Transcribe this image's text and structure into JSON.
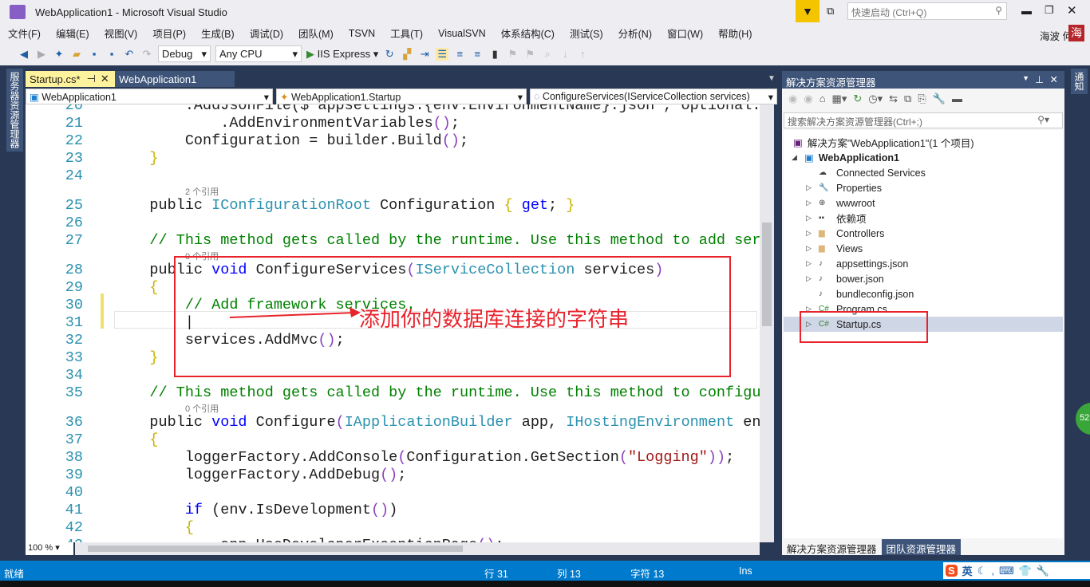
{
  "window": {
    "title": "WebApplication1 - Microsoft Visual Studio",
    "quick_launch_placeholder": "快速启动 (Ctrl+Q)",
    "user": "海波 何",
    "avatar": "海"
  },
  "menu": [
    "文件(F)",
    "编辑(E)",
    "视图(V)",
    "项目(P)",
    "生成(B)",
    "调试(D)",
    "团队(M)",
    "TSVN",
    "工具(T)",
    "VisualSVN",
    "体系结构(C)",
    "测试(S)",
    "分析(N)",
    "窗口(W)",
    "帮助(H)"
  ],
  "toolbar": {
    "configuration": "Debug",
    "platform": "Any CPU",
    "run_target": "IIS Express"
  },
  "left_strip": "服务器资源管理器",
  "right_strip": "通知",
  "tabs": [
    {
      "label": "Startup.cs*",
      "active": true
    },
    {
      "label": "WebApplication1",
      "active": false
    }
  ],
  "nav": {
    "project": "WebApplication1",
    "class": "WebApplication1.Startup",
    "member": "ConfigureServices(IServiceCollection services)"
  },
  "editor": {
    "zoom": "100 %",
    "lines": [
      {
        "n": "20",
        "seg": [
          [
            "        .AddJsonFile($\"appsettings.{env.EnvironmentName}.json\", optional: true)",
            ""
          ]
        ]
      },
      {
        "n": "21",
        "seg": [
          [
            "            .AddEnvironmentVariables",
            ""
          ],
          [
            "()",
            "pn"
          ],
          [
            ";",
            ""
          ]
        ]
      },
      {
        "n": "22",
        "seg": [
          [
            "        Configuration = builder.Build",
            ""
          ],
          [
            "()",
            "pn"
          ],
          [
            ";",
            ""
          ]
        ]
      },
      {
        "n": "23",
        "seg": [
          [
            "    }",
            "br"
          ]
        ]
      },
      {
        "n": "24",
        "seg": []
      },
      {
        "lens": "2 个引用"
      },
      {
        "n": "25",
        "seg": [
          [
            "    public ",
            ""
          ],
          [
            "IConfigurationRoot",
            "ty"
          ],
          [
            " Configuration ",
            ""
          ],
          [
            "{",
            "br"
          ],
          [
            " ",
            ""
          ],
          [
            "get",
            "kw"
          ],
          [
            "; ",
            ""
          ],
          [
            "}",
            "br"
          ]
        ]
      },
      {
        "n": "26",
        "seg": []
      },
      {
        "n": "27",
        "seg": [
          [
            "    // This method gets called by the runtime. Use this method to add services to the container.",
            "cm"
          ]
        ]
      },
      {
        "lens": "0 个引用"
      },
      {
        "n": "28",
        "seg": [
          [
            "    public ",
            ""
          ],
          [
            "void",
            "kw"
          ],
          [
            " ConfigureServices",
            ""
          ],
          [
            "(",
            "pn"
          ],
          [
            "IServiceCollection",
            "ty"
          ],
          [
            " services",
            ""
          ],
          [
            ")",
            "pn"
          ]
        ]
      },
      {
        "n": "29",
        "seg": [
          [
            "    {",
            "br"
          ]
        ]
      },
      {
        "n": "30",
        "seg": [
          [
            "        // Add framework services.",
            "cm"
          ]
        ]
      },
      {
        "n": "31",
        "seg": [
          [
            "        |",
            ""
          ]
        ]
      },
      {
        "n": "32",
        "seg": [
          [
            "        services.AddMvc",
            ""
          ],
          [
            "()",
            "pn"
          ],
          [
            ";",
            ""
          ]
        ]
      },
      {
        "n": "33",
        "seg": [
          [
            "    }",
            "br"
          ]
        ]
      },
      {
        "n": "34",
        "seg": []
      },
      {
        "n": "35",
        "seg": [
          [
            "    // This method gets called by the runtime. Use this method to configure the HTTP request pipeline.",
            "cm"
          ]
        ]
      },
      {
        "lens": "0 个引用"
      },
      {
        "n": "36",
        "seg": [
          [
            "    public ",
            ""
          ],
          [
            "void",
            "kw"
          ],
          [
            " Configure",
            ""
          ],
          [
            "(",
            "pn"
          ],
          [
            "IApplicationBuilder",
            "ty"
          ],
          [
            " app, ",
            ""
          ],
          [
            "IHostingEnvironment",
            "ty"
          ],
          [
            " env",
            ""
          ]
        ]
      },
      {
        "n": "37",
        "seg": [
          [
            "    {",
            "br"
          ]
        ]
      },
      {
        "n": "38",
        "seg": [
          [
            "        loggerFactory.AddConsole",
            ""
          ],
          [
            "(",
            "pn"
          ],
          [
            "Configuration.GetSection",
            ""
          ],
          [
            "(",
            "pn"
          ],
          [
            "\"Logging\"",
            "st"
          ],
          [
            "))",
            "pn"
          ],
          [
            ";",
            ""
          ]
        ]
      },
      {
        "n": "39",
        "seg": [
          [
            "        loggerFactory.AddDebug",
            ""
          ],
          [
            "()",
            "pn"
          ],
          [
            ";",
            ""
          ]
        ]
      },
      {
        "n": "40",
        "seg": []
      },
      {
        "n": "41",
        "seg": [
          [
            "        ",
            ""
          ],
          [
            "if",
            "kw"
          ],
          [
            " (env.IsDevelopment",
            ""
          ],
          [
            "()",
            "pn"
          ],
          [
            ")",
            ""
          ]
        ]
      },
      {
        "n": "42",
        "seg": [
          [
            "        {",
            "br"
          ]
        ]
      },
      {
        "n": "43",
        "seg": [
          [
            "            app.UseDeveloperExceptionPage",
            ""
          ],
          [
            "()",
            "pn"
          ],
          [
            ";",
            ""
          ]
        ]
      }
    ]
  },
  "annotation": {
    "text": "添加你的数据库连接的字符串",
    "color": "#e8232c"
  },
  "solution_explorer": {
    "title": "解决方案资源管理器",
    "search_placeholder": "搜索解决方案资源管理器(Ctrl+;)",
    "root": "解决方案\"WebApplication1\"(1 个项目)",
    "project": "WebApplication1",
    "items": [
      {
        "label": "Connected Services",
        "icon": "cloud-icon",
        "exp": false
      },
      {
        "label": "Properties",
        "icon": "wrench-icon",
        "exp": true
      },
      {
        "label": "wwwroot",
        "icon": "globe-icon",
        "exp": true
      },
      {
        "label": "依赖项",
        "icon": "dependencies-icon",
        "exp": true
      },
      {
        "label": "Controllers",
        "icon": "folder-icon",
        "exp": true
      },
      {
        "label": "Views",
        "icon": "folder-icon",
        "exp": true
      },
      {
        "label": "appsettings.json",
        "icon": "json-file-icon",
        "exp": true
      },
      {
        "label": "bower.json",
        "icon": "json-file-icon",
        "exp": true
      },
      {
        "label": "bundleconfig.json",
        "icon": "json-file-icon",
        "exp": false
      },
      {
        "label": "Program.cs",
        "icon": "csharp-file-icon",
        "exp": true
      },
      {
        "label": "Startup.cs",
        "icon": "csharp-file-icon",
        "exp": true,
        "selected": true
      }
    ],
    "bottom_tabs": [
      "解决方案资源管理器",
      "团队资源管理器"
    ]
  },
  "status": {
    "ready": "就绪",
    "row": "行 31",
    "col": "列 13",
    "char": "字符 13",
    "mode": "Ins",
    "ime": "英"
  },
  "colors": {
    "accent": "#007acc",
    "frame": "#293955",
    "annotation": "#e8232c"
  }
}
